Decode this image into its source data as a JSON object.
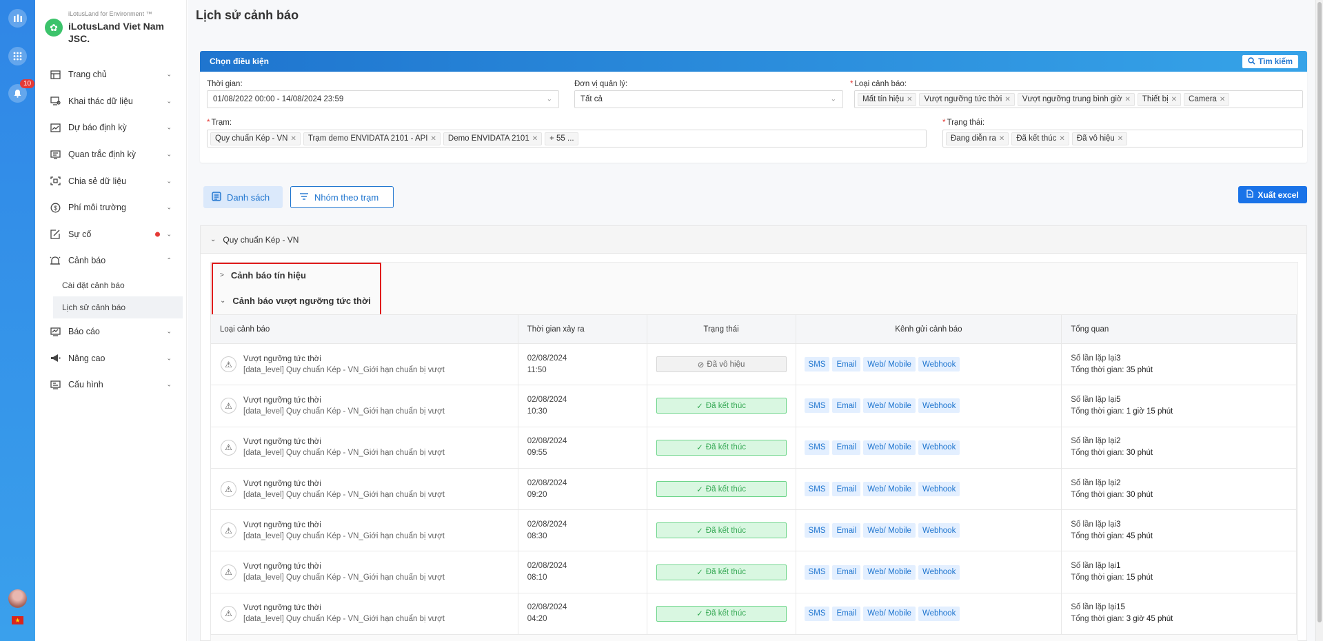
{
  "rail": {
    "notification_count": "10"
  },
  "brand": {
    "tagline": "iLotusLand for Environment ™",
    "name": "iLotusLand Viet Nam JSC."
  },
  "nav": [
    {
      "label": "Trang chủ",
      "icon": "home-icon"
    },
    {
      "label": "Khai thác dữ liệu",
      "icon": "data-mining-icon"
    },
    {
      "label": "Dự báo định kỳ",
      "icon": "forecast-icon"
    },
    {
      "label": "Quan trắc định kỳ",
      "icon": "monitoring-icon"
    },
    {
      "label": "Chia sẻ dữ liệu",
      "icon": "share-icon"
    },
    {
      "label": "Phí môi trường",
      "icon": "fee-icon"
    },
    {
      "label": "Sự cố",
      "icon": "incident-icon"
    },
    {
      "label": "Cảnh báo",
      "icon": "bell-icon"
    }
  ],
  "nav_sub": [
    "Cài đặt cảnh báo",
    "Lịch sử cảnh báo"
  ],
  "nav_bottom": [
    {
      "label": "Báo cáo",
      "icon": "report-icon"
    },
    {
      "label": "Nâng cao",
      "icon": "advanced-icon"
    },
    {
      "label": "Cấu hình",
      "icon": "config-icon"
    }
  ],
  "page": {
    "title": "Lịch sử cảnh báo"
  },
  "filter": {
    "header": "Chọn điều kiện",
    "search_label": "Tìm kiếm",
    "time_label": "Thời gian:",
    "time_value": "01/08/2022 00:00 - 14/08/2024 23:59",
    "unit_label": "Đơn vị quản lý:",
    "unit_value": "Tất cả",
    "type_label": "Loại cảnh báo:",
    "type_tags": [
      "Mất tín hiệu",
      "Vượt ngưỡng tức thời",
      "Vượt ngưỡng trung bình giờ",
      "Thiết bị",
      "Camera"
    ],
    "station_label": "Trạm:",
    "station_tags": [
      "Quy chuẩn Kép - VN",
      "Trạm demo ENVIDATA 2101 - API",
      "Demo ENVIDATA 2101",
      "+ 55 ..."
    ],
    "status_label": "Trạng thái:",
    "status_tags": [
      "Đang diễn ra",
      "Đã kết thúc",
      "Đã vô hiệu"
    ]
  },
  "views": {
    "list": "Danh sách",
    "group": "Nhóm theo trạm",
    "excel": "Xuất excel"
  },
  "station": {
    "name": "Quy chuẩn Kép - VN"
  },
  "groups": {
    "signal": "Cảnh báo tín hiệu",
    "threshold": "Cảnh báo vượt ngưỡng tức thời"
  },
  "table": {
    "headers": [
      "Loại cảnh báo",
      "Thời gian xảy ra",
      "Trạng thái",
      "Kênh gửi cảnh báo",
      "Tổng quan"
    ],
    "channels": [
      "SMS",
      "Email",
      "Web/ Mobile",
      "Webhook"
    ],
    "repeat_label": "Số lần lặp lại",
    "duration_label": "Tổng thời gian:",
    "rows": [
      {
        "title": "Vượt ngưỡng tức thời",
        "desc": "[data_level] Quy chuẩn Kép - VN_Giới hạn chuẩn bị vượt",
        "date": "02/08/2024",
        "time": "11:50",
        "status": "Đã vô hiệu",
        "status_kind": "disabled",
        "repeat": "3",
        "duration": "35 phút"
      },
      {
        "title": "Vượt ngưỡng tức thời",
        "desc": "[data_level] Quy chuẩn Kép - VN_Giới hạn chuẩn bị vượt",
        "date": "02/08/2024",
        "time": "10:30",
        "status": "Đã kết thúc",
        "status_kind": "done",
        "repeat": "5",
        "duration": "1 giờ 15 phút"
      },
      {
        "title": "Vượt ngưỡng tức thời",
        "desc": "[data_level] Quy chuẩn Kép - VN_Giới hạn chuẩn bị vượt",
        "date": "02/08/2024",
        "time": "09:55",
        "status": "Đã kết thúc",
        "status_kind": "done",
        "repeat": "2",
        "duration": "30 phút"
      },
      {
        "title": "Vượt ngưỡng tức thời",
        "desc": "[data_level] Quy chuẩn Kép - VN_Giới hạn chuẩn bị vượt",
        "date": "02/08/2024",
        "time": "09:20",
        "status": "Đã kết thúc",
        "status_kind": "done",
        "repeat": "2",
        "duration": "30 phút"
      },
      {
        "title": "Vượt ngưỡng tức thời",
        "desc": "[data_level] Quy chuẩn Kép - VN_Giới hạn chuẩn bị vượt",
        "date": "02/08/2024",
        "time": "08:30",
        "status": "Đã kết thúc",
        "status_kind": "done",
        "repeat": "3",
        "duration": "45 phút"
      },
      {
        "title": "Vượt ngưỡng tức thời",
        "desc": "[data_level] Quy chuẩn Kép - VN_Giới hạn chuẩn bị vượt",
        "date": "02/08/2024",
        "time": "08:10",
        "status": "Đã kết thúc",
        "status_kind": "done",
        "repeat": "1",
        "duration": "15 phút"
      },
      {
        "title": "Vượt ngưỡng tức thời",
        "desc": "[data_level] Quy chuẩn Kép - VN_Giới hạn chuẩn bị vượt",
        "date": "02/08/2024",
        "time": "04:20",
        "status": "Đã kết thúc",
        "status_kind": "done",
        "repeat": "15",
        "duration": "3 giờ 45 phút"
      }
    ]
  }
}
